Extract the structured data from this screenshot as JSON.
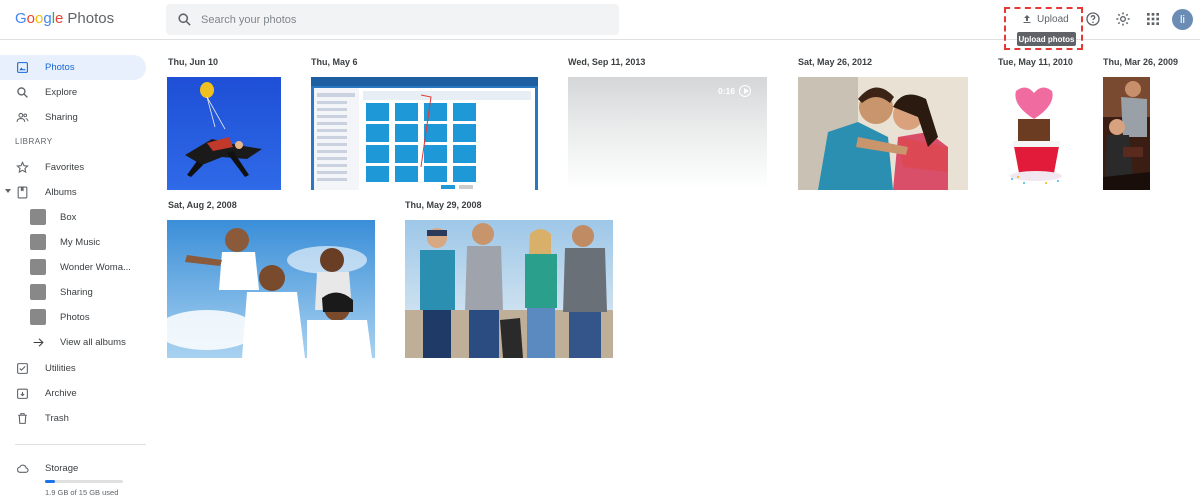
{
  "app": {
    "logo_letters": [
      "G",
      "o",
      "o",
      "g",
      "l",
      "e"
    ],
    "product": "Photos"
  },
  "search": {
    "placeholder": "Search your photos"
  },
  "header": {
    "upload_label": "Upload",
    "tooltip": "Upload photos",
    "avatar_initial": "li"
  },
  "sidebar": {
    "items": [
      {
        "label": "Photos",
        "icon": "photo-icon"
      },
      {
        "label": "Explore",
        "icon": "search-icon"
      },
      {
        "label": "Sharing",
        "icon": "people-icon"
      }
    ],
    "library_label": "LIBRARY",
    "library_items": [
      {
        "label": "Favorites",
        "icon": "star-icon"
      },
      {
        "label": "Albums",
        "icon": "album-icon"
      }
    ],
    "albums": [
      {
        "label": "Box"
      },
      {
        "label": "My Music"
      },
      {
        "label": "Wonder Woma..."
      },
      {
        "label": "Sharing"
      },
      {
        "label": "Photos"
      }
    ],
    "view_all_albums": "View all albums",
    "bottom_items": [
      {
        "label": "Utilities",
        "icon": "utilities-icon"
      },
      {
        "label": "Archive",
        "icon": "archive-icon"
      },
      {
        "label": "Trash",
        "icon": "trash-icon"
      }
    ],
    "storage": {
      "label": "Storage",
      "used_text": "1.9 GB of 15 GB used",
      "fraction": 0.127
    }
  },
  "groups": [
    {
      "date": "Thu, Jun 10",
      "photo": "skydiving photo"
    },
    {
      "date": "Thu, May 6",
      "photo": "cloud drive screenshot"
    },
    {
      "date": "Wed, Sep 11, 2013",
      "photo": "video",
      "duration": "0:16"
    },
    {
      "date": "Sat, May 26, 2012",
      "photo": "couple photo"
    },
    {
      "date": "Tue, May 11, 2010",
      "photo": "cupcake photo"
    },
    {
      "date": "Thu, Mar 26, 2009",
      "photo": "party photo"
    },
    {
      "date": "Sat, Aug 2, 2008",
      "photo": "family photo"
    },
    {
      "date": "Thu, May 29, 2008",
      "photo": "friends photo"
    }
  ],
  "colors": {
    "accent": "#1a73e8",
    "active_bg": "#e8f0fe",
    "highlight": "#e53935"
  }
}
